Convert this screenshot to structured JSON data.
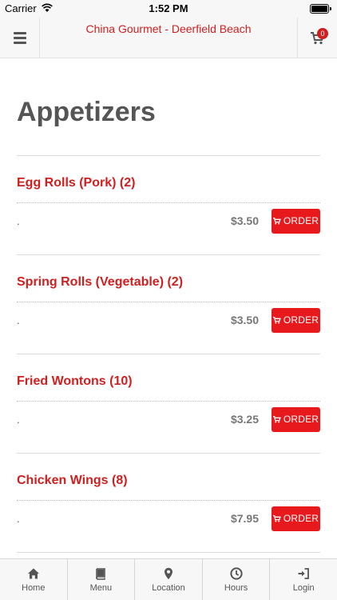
{
  "status_bar": {
    "carrier": "Carrier",
    "time": "1:52 PM"
  },
  "header": {
    "title": "China Gourmet - Deerfield Beach",
    "cart_count": "0"
  },
  "section": {
    "title": "Appetizers"
  },
  "items": [
    {
      "name": "Egg Rolls (Pork) (2)",
      "description": ".",
      "price": "$3.50",
      "order_label": "ORDER"
    },
    {
      "name": "Spring Rolls (Vegetable) (2)",
      "description": ".",
      "price": "$3.50",
      "order_label": "ORDER"
    },
    {
      "name": "Fried Wontons (10)",
      "description": ".",
      "price": "$3.25",
      "order_label": "ORDER"
    },
    {
      "name": "Chicken Wings (8)",
      "description": ".",
      "price": "$7.95",
      "order_label": "ORDER"
    }
  ],
  "bottom_nav": [
    {
      "label": "Home",
      "icon": "home-icon"
    },
    {
      "label": "Menu",
      "icon": "book-icon"
    },
    {
      "label": "Location",
      "icon": "map-pin-icon"
    },
    {
      "label": "Hours",
      "icon": "clock-icon"
    },
    {
      "label": "Login",
      "icon": "login-icon"
    }
  ],
  "colors": {
    "accent": "#e8191c",
    "title_red": "#d01f1f",
    "heading_gray": "#555555"
  }
}
